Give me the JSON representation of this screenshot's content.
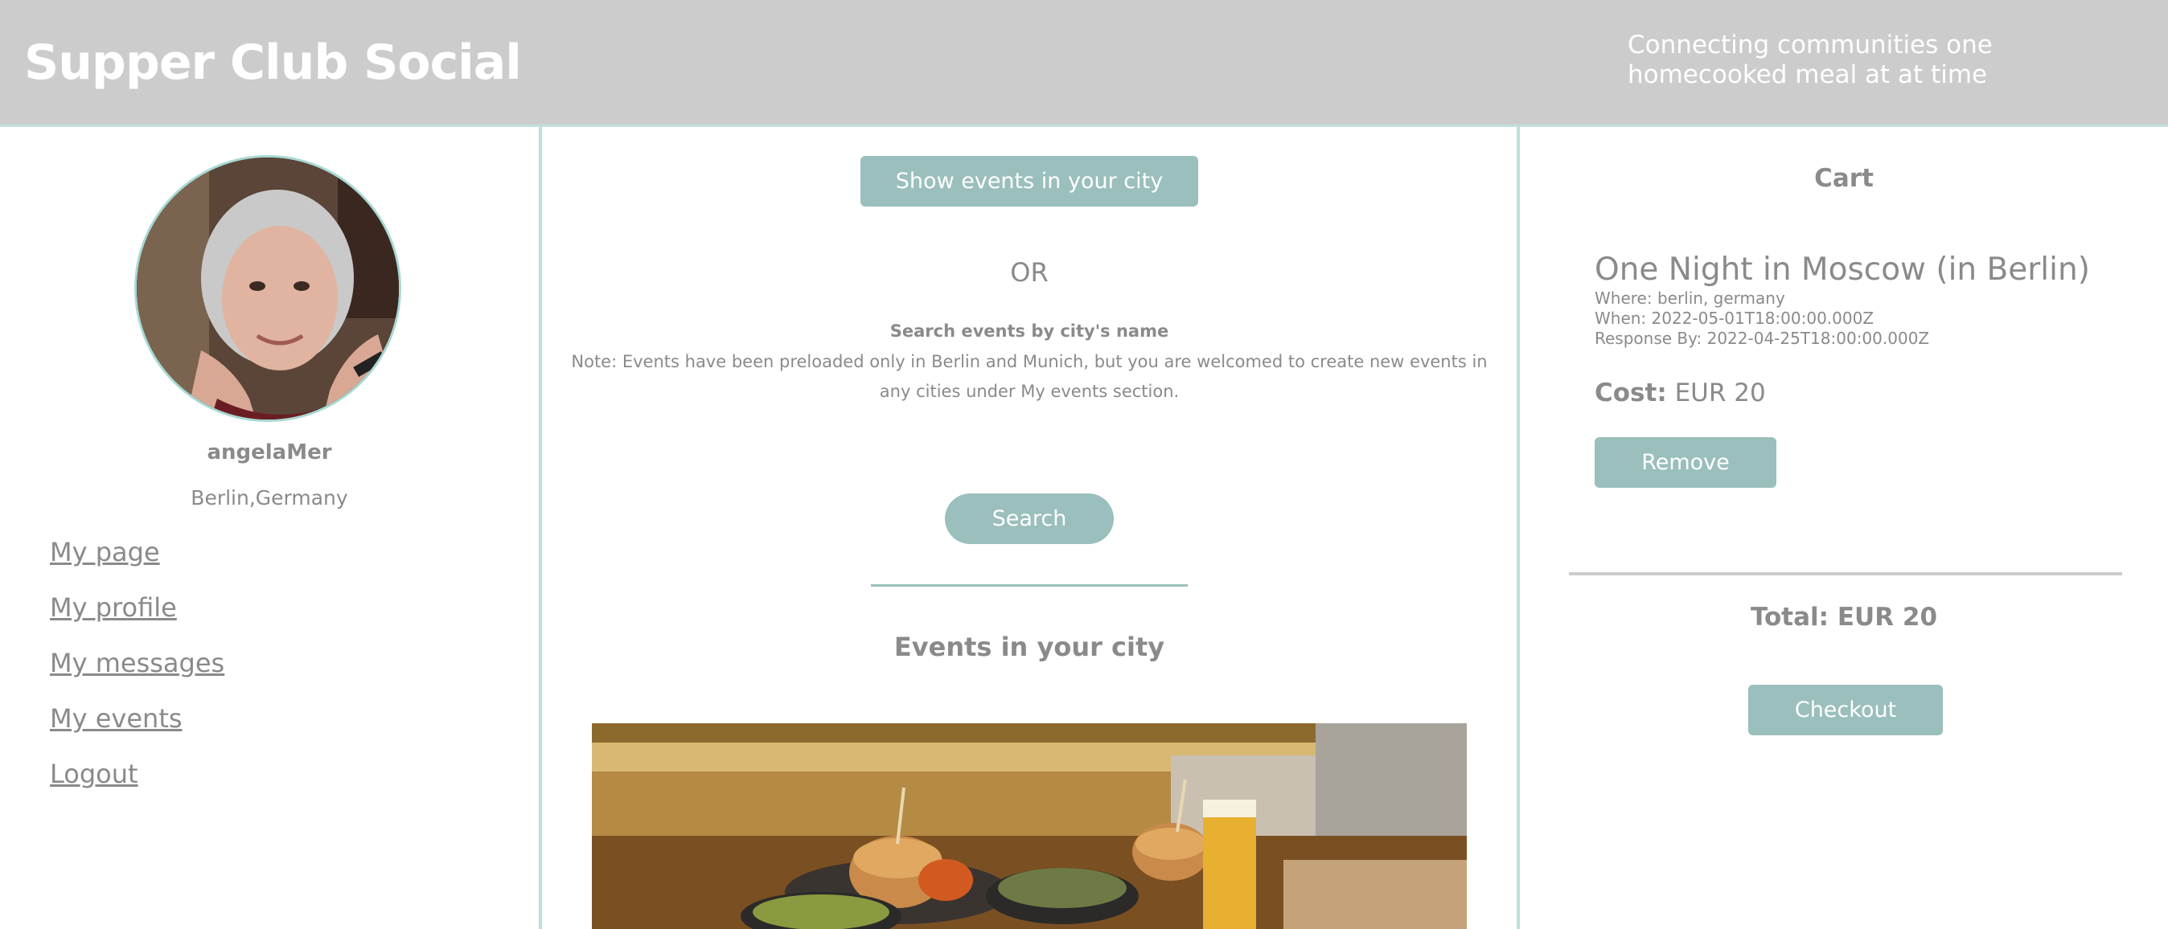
{
  "header": {
    "brand": "Supper Club Social",
    "tagline": "Connecting communities one homecooked meal at at time"
  },
  "sidebar": {
    "username": "angelaMer",
    "city": "Berlin,Germany",
    "nav": [
      {
        "label": "My page"
      },
      {
        "label": "My profile"
      },
      {
        "label": "My messages"
      },
      {
        "label": "My events"
      },
      {
        "label": "Logout"
      }
    ]
  },
  "main": {
    "show_city_button": "Show events in your city",
    "or_text": "OR",
    "search_title": "Search events by city's name",
    "note": "Note: Events have been preloaded only in Berlin and Munich, but you are welcomed to create new events in any cities under My events section.",
    "search_value": "",
    "search_button": "Search",
    "events_title": "Events in your city"
  },
  "cart": {
    "title": "Cart",
    "item": {
      "name": "One Night in Moscow (in Berlin)",
      "where": "Where: berlin, germany",
      "when": "When: 2022-05-01T18:00:00.000Z",
      "response_by": "Response By: 2022-04-25T18:00:00.000Z",
      "cost_label": "Cost:",
      "cost_value": "EUR 20",
      "remove_button": "Remove"
    },
    "total": "Total: EUR 20",
    "checkout_button": "Checkout"
  },
  "colors": {
    "header_bg": "#cccccc",
    "accent": "#9abfbc",
    "divider": "#bfe0dd",
    "text": "#8a8a8a"
  }
}
